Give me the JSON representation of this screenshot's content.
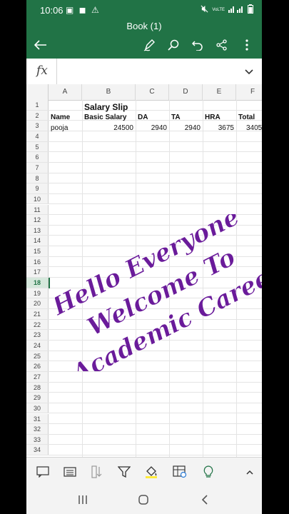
{
  "status_bar": {
    "time": "10:06",
    "left_icons": "▣ ◼ ⚠",
    "right_text": "VoLTE"
  },
  "toolbar": {
    "title": "Book (1)"
  },
  "formula_bar": {
    "fx_label": "fx",
    "value": ""
  },
  "columns": [
    "A",
    "B",
    "C",
    "D",
    "E",
    "F"
  ],
  "rows": [
    "1",
    "2",
    "3",
    "4",
    "5",
    "6",
    "7",
    "8",
    "9",
    "10",
    "11",
    "12",
    "13",
    "14",
    "15",
    "16",
    "17",
    "18",
    "19",
    "20",
    "21",
    "22",
    "23",
    "24",
    "25",
    "26",
    "27",
    "28",
    "29",
    "30",
    "31",
    "32",
    "33",
    "34"
  ],
  "selected_row": "18",
  "sheet": {
    "title": "Salary Slip",
    "headers": [
      "Name",
      "Basic Salary",
      "DA",
      "TA",
      "HRA",
      "Total"
    ],
    "record": [
      "pooja",
      "24500",
      "2940",
      "2940",
      "3675",
      "3405"
    ]
  },
  "overlay": {
    "line1": "Hello Everyone",
    "line2": "Welcome To",
    "line3": "Academic Career",
    "color": "#6a1b9a"
  },
  "colors": {
    "accent": "#217346"
  }
}
